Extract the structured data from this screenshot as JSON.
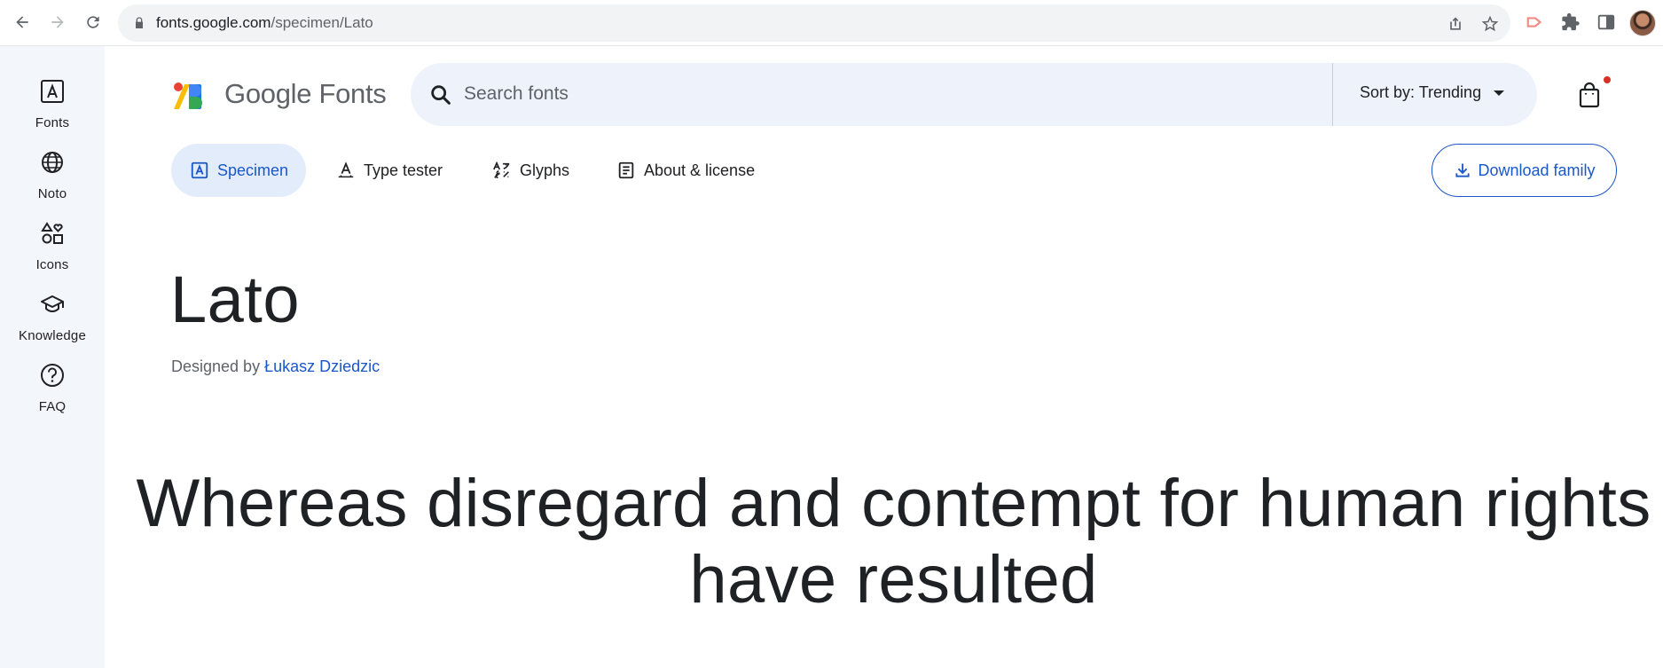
{
  "browser": {
    "url_host": "fonts.google.com",
    "url_path": "/specimen/Lato",
    "icons": {
      "back": "back-arrow-icon",
      "forward": "forward-arrow-icon",
      "reload": "reload-icon",
      "lock": "lock-icon",
      "share": "share-icon",
      "bookmark": "star-icon",
      "extension_red": "extension-arrow-icon",
      "extensions": "puzzle-icon",
      "side_panel": "side-panel-icon",
      "profile": "avatar"
    }
  },
  "rail": {
    "items": [
      {
        "label": "Fonts",
        "icon": "font-a-icon"
      },
      {
        "label": "Noto",
        "icon": "globe-icon"
      },
      {
        "label": "Icons",
        "icon": "shapes-icon"
      },
      {
        "label": "Knowledge",
        "icon": "graduation-cap-icon"
      },
      {
        "label": "FAQ",
        "icon": "help-circle-icon"
      }
    ]
  },
  "header": {
    "brand": "Google Fonts",
    "search_placeholder": "Search fonts",
    "sort_label": "Sort by: Trending",
    "colors": {
      "brand_accent": "#1a57c8",
      "rail_bg": "#f3f6fb",
      "search_bg": "#eef3fb",
      "notification_dot": "#d93025"
    }
  },
  "tabs": [
    {
      "label": "Specimen",
      "active": true,
      "icon": "specimen-icon"
    },
    {
      "label": "Type tester",
      "active": false,
      "icon": "type-tester-icon"
    },
    {
      "label": "Glyphs",
      "active": false,
      "icon": "glyphs-icon"
    },
    {
      "label": "About & license",
      "active": false,
      "icon": "article-icon"
    }
  ],
  "download_label": "Download family",
  "font": {
    "name": "Lato",
    "designed_by_prefix": "Designed by",
    "designer": "Łukasz Dziedzic"
  },
  "sample": {
    "line1": "Whereas disregard and contempt for human rights",
    "line2": "have resulted"
  }
}
